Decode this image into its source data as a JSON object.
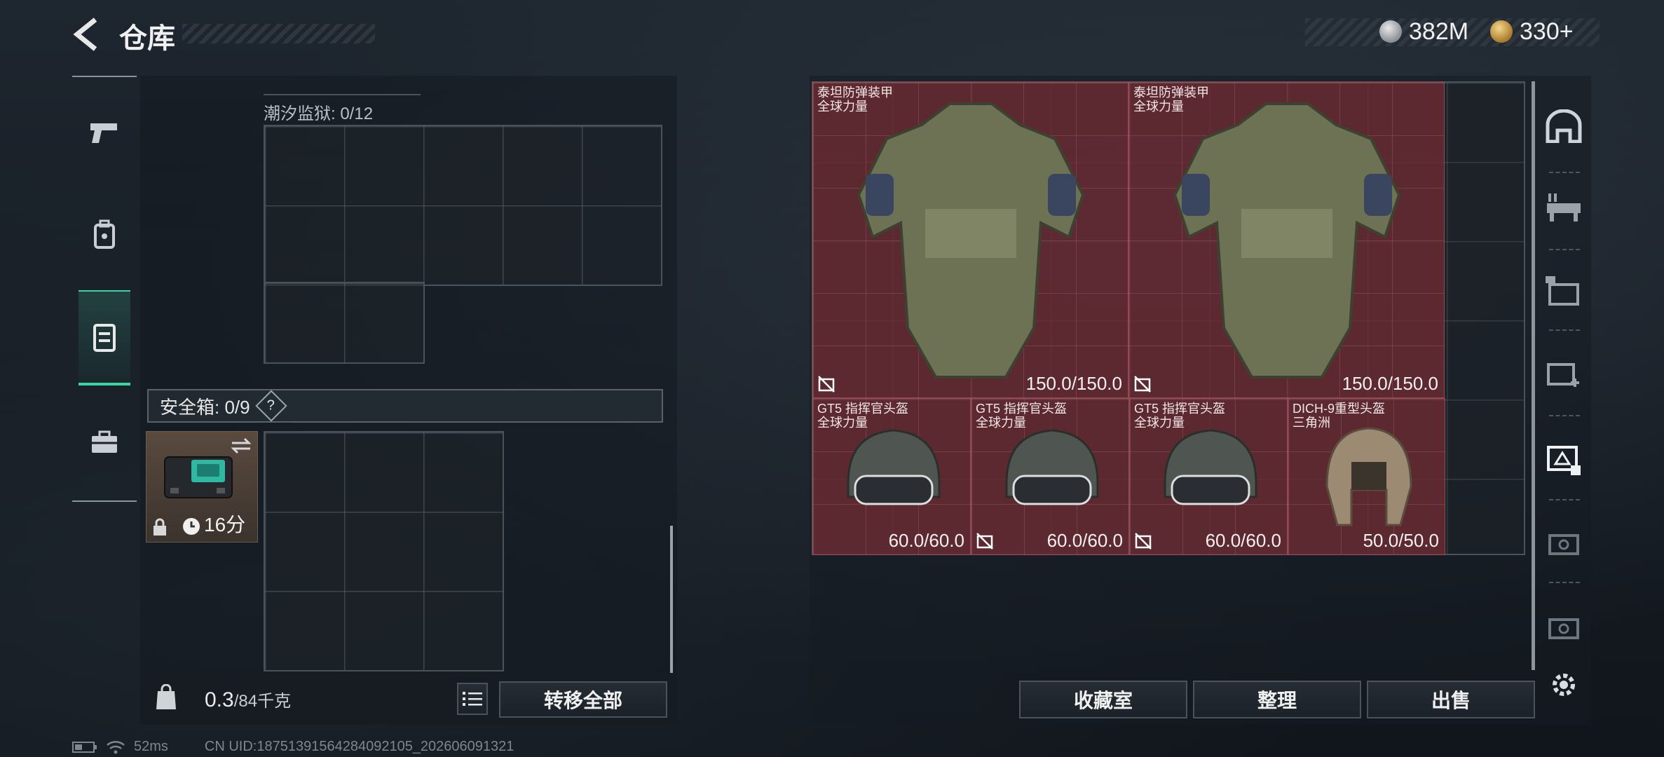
{
  "header": {
    "title": "仓库"
  },
  "currency": {
    "silver": "382M",
    "gold": "330+"
  },
  "container": {
    "label": "潮汐监狱: 0/12"
  },
  "safebox": {
    "label": "安全箱: 0/9",
    "help": "?",
    "timer": "16分"
  },
  "footer": {
    "weight_value": "0.3",
    "weight_unit": "/84千克",
    "transfer_all": "转移全部"
  },
  "actions": {
    "collection": "收藏室",
    "organize": "整理",
    "sell": "出售"
  },
  "items": [
    {
      "name": "泰坦防弹装甲",
      "sub": "全球力量",
      "durability": "150.0/150.0"
    },
    {
      "name": "泰坦防弹装甲",
      "sub": "全球力量",
      "durability": "150.0/150.0"
    },
    {
      "name": "GT5 指挥官头盔",
      "sub": "全球力量",
      "durability": "60.0/60.0"
    },
    {
      "name": "GT5 指挥官头盔",
      "sub": "全球力量",
      "durability": "60.0/60.0"
    },
    {
      "name": "GT5 指挥官头盔",
      "sub": "全球力量",
      "durability": "60.0/60.0"
    },
    {
      "name": "DICH-9重型头盔",
      "sub": "三角洲",
      "durability": "50.0/50.0"
    }
  ],
  "status": {
    "ping": "52ms",
    "uid": "CN UID:18751391564284092105_202606091321"
  },
  "icons": {
    "back": "back-arrow-icon",
    "nav": [
      "pistol-icon",
      "backpack-icon",
      "vest-icon",
      "toolbox-icon"
    ],
    "side": [
      "helmet-bunker-icon",
      "workbench-icon",
      "folder-icon",
      "medical-icon",
      "safe-icon",
      "crate-icon",
      "crate-icon",
      "gear-icon"
    ]
  },
  "colors": {
    "accent": "#3fd3a4",
    "item_bg": "#702c34"
  }
}
